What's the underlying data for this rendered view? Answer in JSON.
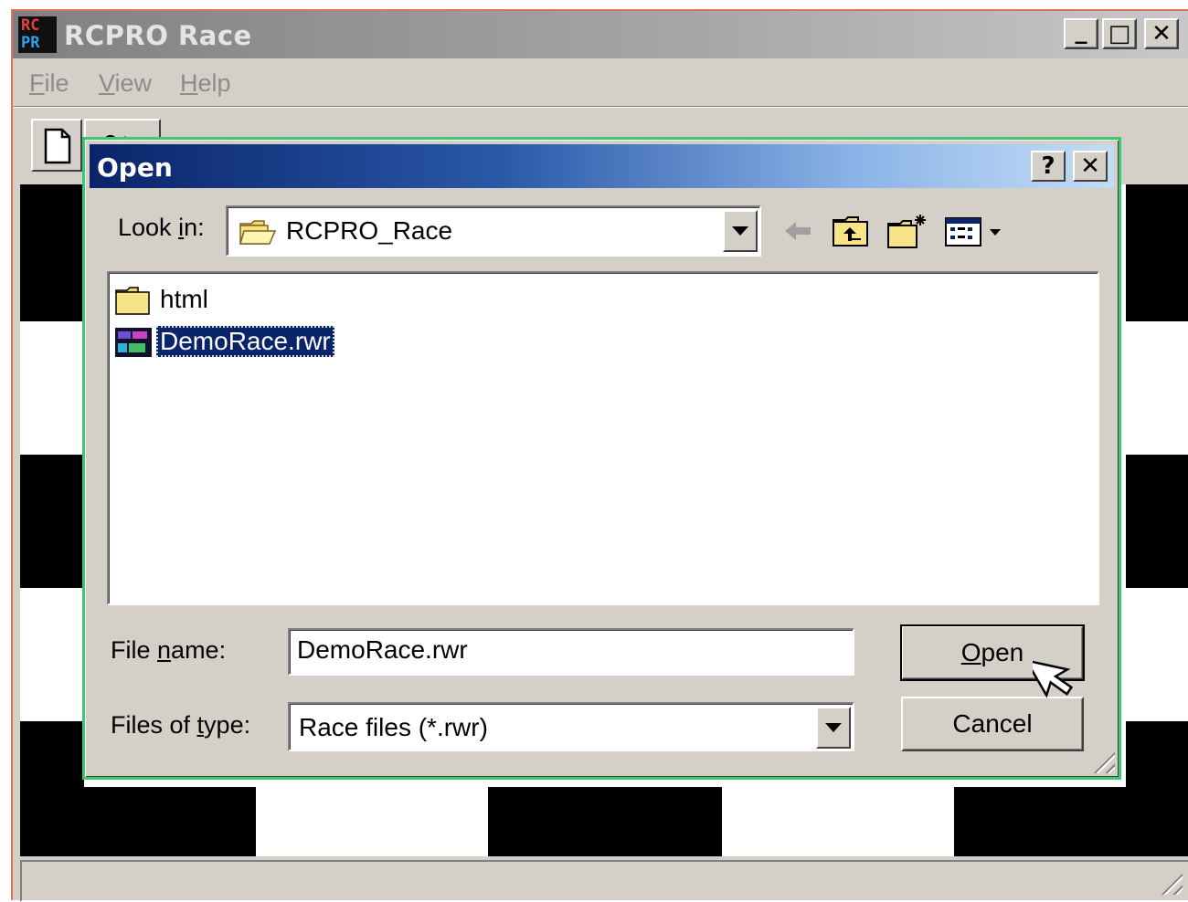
{
  "main_window": {
    "title": "RCPRO Race",
    "icon_letters": {
      "top": "RC",
      "bottom": "PR"
    },
    "controls": {
      "minimize": "_",
      "maximize": "□",
      "close": "✕"
    }
  },
  "menu": {
    "file": {
      "accel": "F",
      "rest": "ile"
    },
    "view": {
      "accel": "V",
      "rest": "iew"
    },
    "help": {
      "accel": "H",
      "rest": "elp"
    }
  },
  "toolbar": {
    "icons": [
      "new-document-icon",
      "open-icon"
    ]
  },
  "dialog": {
    "title": "Open",
    "help_glyph": "?",
    "close_glyph": "✕",
    "look_in": {
      "label_pre": "Look ",
      "label_accel": "i",
      "label_post": "n:",
      "value": "RCPRO_Race"
    },
    "toolbar_icons": [
      "back-arrow-icon",
      "up-one-level-icon",
      "create-new-folder-icon",
      "view-menu-icon"
    ],
    "files": [
      {
        "name": "html",
        "type": "folder",
        "selected": false
      },
      {
        "name": "DemoRace.rwr",
        "type": "race-file",
        "selected": true
      }
    ],
    "file_name": {
      "label_pre": "File ",
      "label_accel": "n",
      "label_post": "ame:",
      "value": "DemoRace.rwr"
    },
    "file_type": {
      "label_pre": "Files of ",
      "label_accel": "t",
      "label_post": "ype:",
      "value": "Race files (*.rwr)"
    },
    "buttons": {
      "open": {
        "accel": "O",
        "rest": "pen"
      },
      "cancel": "Cancel"
    }
  },
  "colors": {
    "window_face": "#d4d0c8",
    "dialog_title_start": "#0a246a",
    "dialog_title_end": "#c4dcf4",
    "selection": "#0a246a",
    "dialog_frame_highlight": "#3cc86e",
    "disabled_text": "#8c8c8c"
  }
}
